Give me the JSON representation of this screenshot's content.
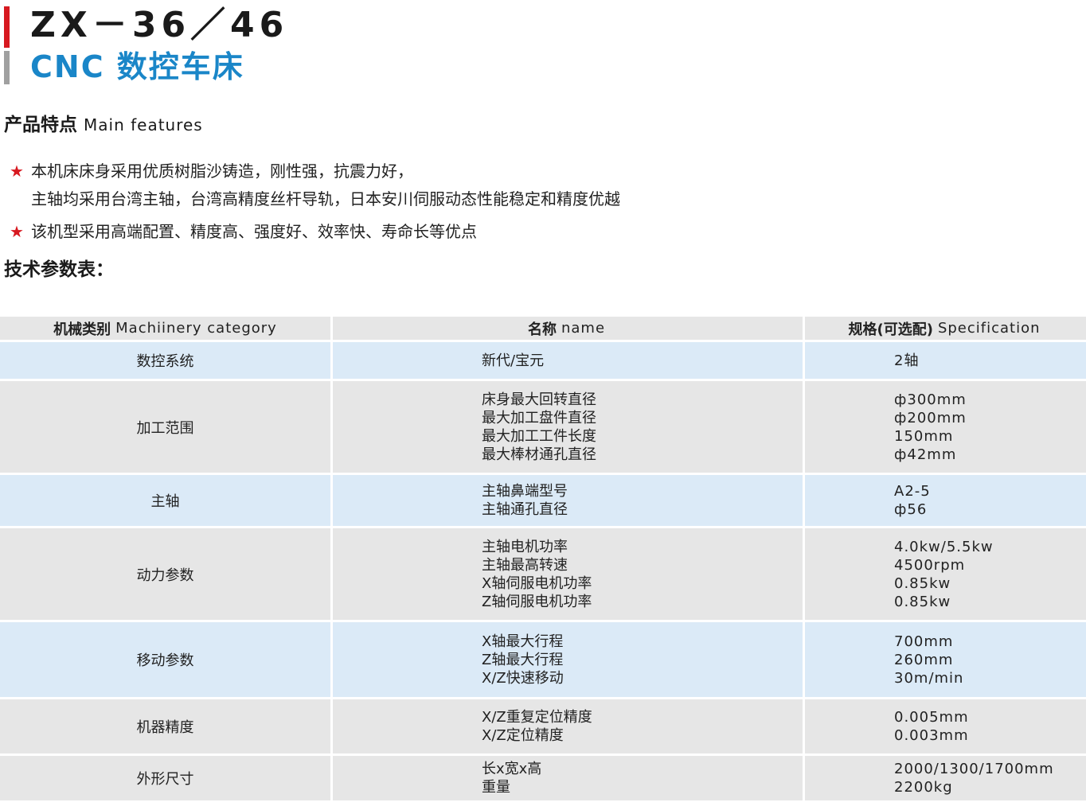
{
  "header": {
    "model": "ZX－36／46",
    "subtitle": "CNC 数控车床"
  },
  "features_section": {
    "title_cn": "产品特点",
    "title_en": "Main features",
    "star_glyph": "★",
    "items": [
      {
        "lines": [
          "本机床床身采用优质树脂沙铸造，刚性强，抗震力好，",
          "主轴均采用台湾主轴，台湾高精度丝杆导轨，日本安川伺服动态性能稳定和精度优越"
        ]
      },
      {
        "lines": [
          "该机型采用高端配置、精度高、强度好、效率快、寿命长等优点"
        ]
      }
    ]
  },
  "spec_section": {
    "title": "技术参数表："
  },
  "table": {
    "headers": [
      {
        "cn": "机械类别",
        "en": "Machiinery category"
      },
      {
        "cn": "名称",
        "en": "name"
      },
      {
        "cn": "规格(可选配)",
        "en": "Specification"
      }
    ],
    "rows": [
      {
        "category": "数控系统",
        "names": [
          "新代/宝元"
        ],
        "specs": [
          "2轴"
        ],
        "style": "blue"
      },
      {
        "category": "加工范围",
        "names": [
          "床身最大回转直径",
          "最大加工盘件直径",
          "最大加工工件长度",
          "最大棒材通孔直径"
        ],
        "specs": [
          "ф300mm",
          "ф200mm",
          "150mm",
          "ф42mm"
        ],
        "style": "gray"
      },
      {
        "category": "主轴",
        "names": [
          "主轴鼻端型号",
          "主轴通孔直径"
        ],
        "specs": [
          "A2-5",
          "ф56"
        ],
        "style": "blue"
      },
      {
        "category": "动力参数",
        "names": [
          "主轴电机功率",
          "主轴最高转速",
          "X轴伺服电机功率",
          "Z轴伺服电机功率"
        ],
        "specs": [
          "4.0kw/5.5kw",
          "4500rpm",
          "0.85kw",
          "0.85kw"
        ],
        "style": "gray"
      },
      {
        "category": "移动参数",
        "names": [
          "X轴最大行程",
          "Z轴最大行程",
          "X/Z快速移动"
        ],
        "specs": [
          "700mm",
          "260mm",
          "30m/min"
        ],
        "style": "blue"
      },
      {
        "category": "机器精度",
        "names": [
          "X/Z重复定位精度",
          "X/Z定位精度"
        ],
        "specs": [
          "0.005mm",
          "0.003mm"
        ],
        "style": "gray"
      },
      {
        "category": "外形尺寸",
        "names": [
          "长x宽x高",
          "重量"
        ],
        "specs": [
          "2000/1300/1700mm",
          "2200kg"
        ],
        "style": "gray"
      }
    ]
  },
  "colors": {
    "accent_red": "#d71920",
    "title_blue": "#1a86c8",
    "row_blue": "#dbeaf7",
    "row_gray": "#e6e6e6"
  }
}
